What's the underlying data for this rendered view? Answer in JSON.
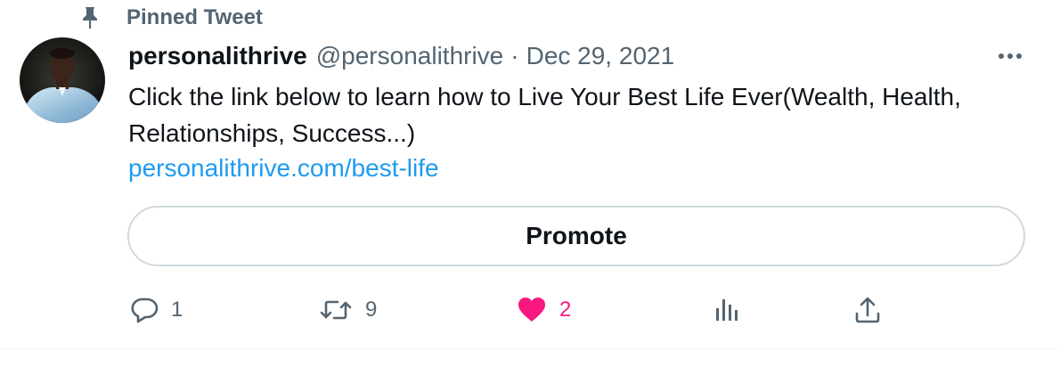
{
  "pinned": {
    "label": "Pinned Tweet",
    "icon": "pin-icon"
  },
  "author": {
    "display_name": "personalithrive",
    "handle": "@personalithrive",
    "separator": "·",
    "date": "Dec 29, 2021"
  },
  "tweet": {
    "text": "Click the link below to learn how to Live Your Best Life Ever(Wealth, Health, Relationships, Success...)",
    "link": "personalithrive.com/best-life"
  },
  "promote": {
    "label": "Promote"
  },
  "actions": {
    "reply": {
      "icon": "reply-icon",
      "count": "1"
    },
    "retweet": {
      "icon": "retweet-icon",
      "count": "9"
    },
    "like": {
      "icon": "heart-icon",
      "count": "2",
      "liked": true
    },
    "analytics": {
      "icon": "analytics-icon"
    },
    "share": {
      "icon": "share-icon"
    }
  },
  "colors": {
    "link": "#1d9bf0",
    "like": "#f91880",
    "secondary": "#536471",
    "text": "#0f1419"
  }
}
